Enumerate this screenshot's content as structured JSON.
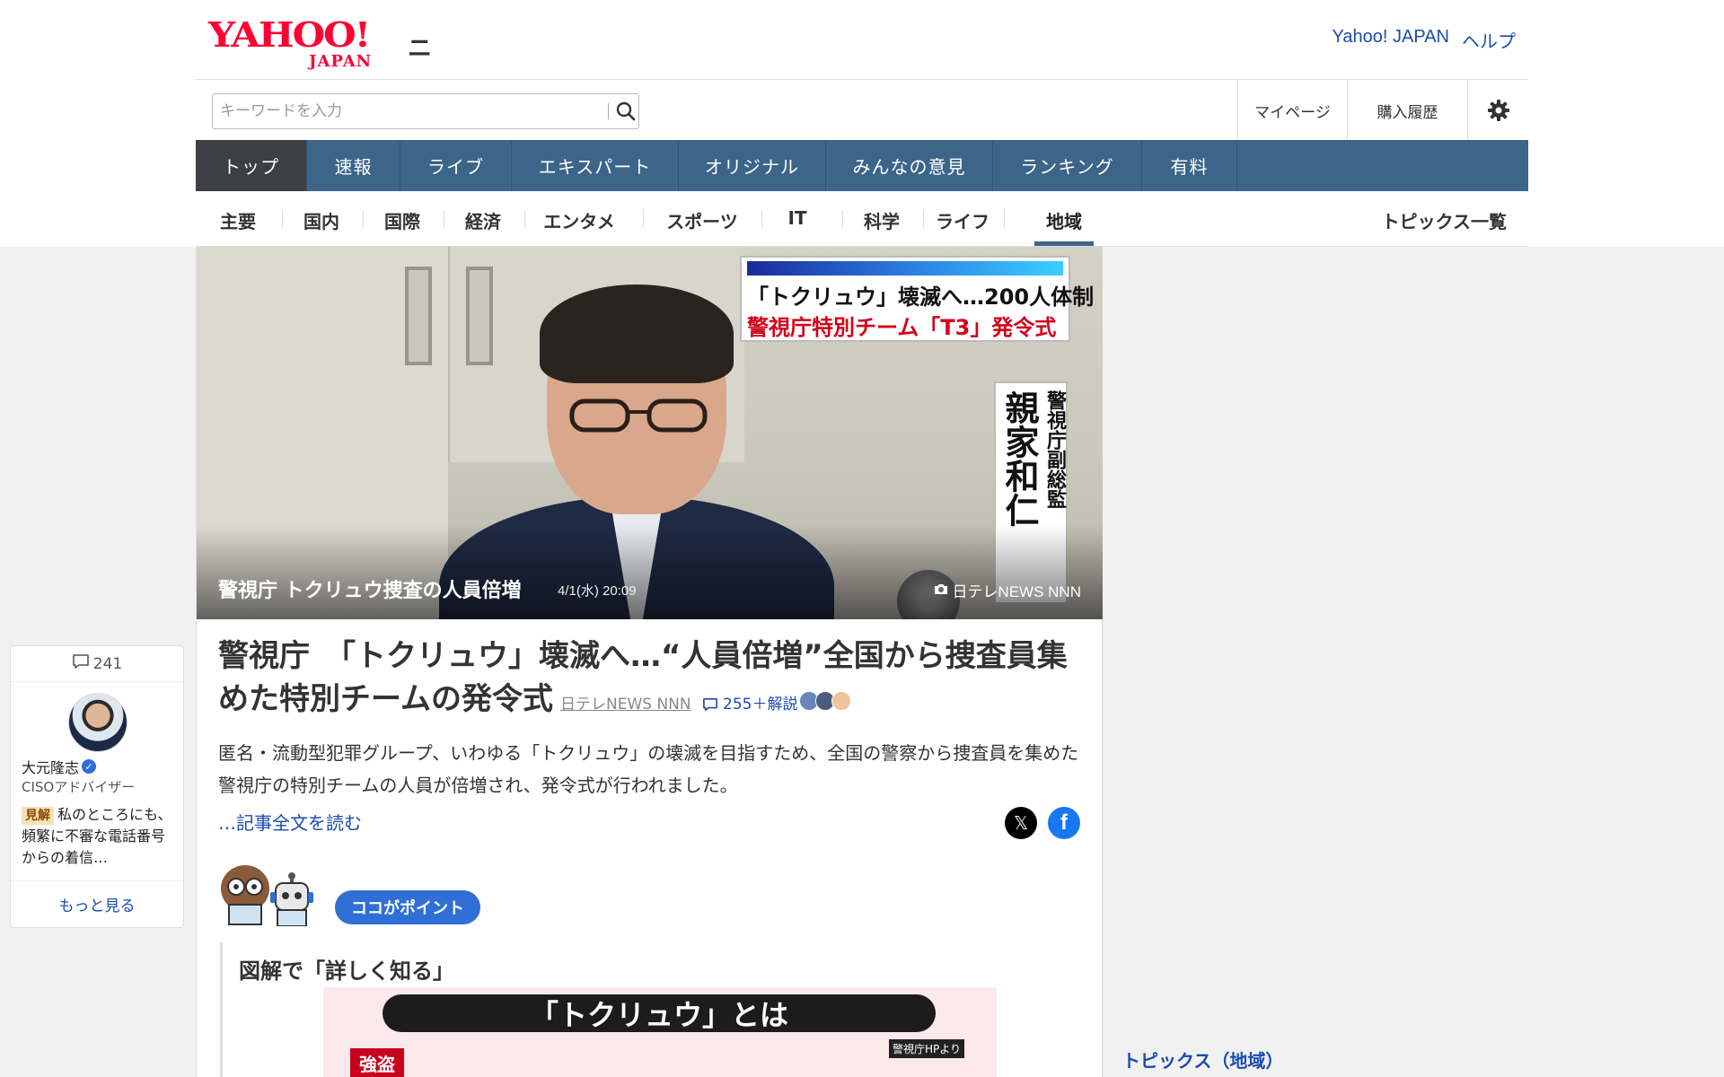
{
  "header": {
    "logo_yahoo": "YAHOO!",
    "logo_japan": "JAPAN",
    "logo_news": "ニュース",
    "link_yahoo_japan": "Yahoo! JAPAN",
    "link_help": "ヘルプ"
  },
  "search": {
    "placeholder": "キーワードを入力",
    "mypage": "マイページ",
    "history": "購入履歴"
  },
  "main_nav": [
    {
      "label": "トップ",
      "active": true
    },
    {
      "label": "速報"
    },
    {
      "label": "ライブ"
    },
    {
      "label": "エキスパート"
    },
    {
      "label": "オリジナル"
    },
    {
      "label": "みんなの意見"
    },
    {
      "label": "ランキング"
    },
    {
      "label": "有料"
    }
  ],
  "sub_nav": [
    {
      "label": "主要"
    },
    {
      "label": "国内"
    },
    {
      "label": "国際"
    },
    {
      "label": "経済"
    },
    {
      "label": "エンタメ"
    },
    {
      "label": "スポーツ"
    },
    {
      "label": "IT"
    },
    {
      "label": "科学"
    },
    {
      "label": "ライフ"
    },
    {
      "label": "地域",
      "active": true
    }
  ],
  "topics_list": "トピックス一覧",
  "comment_widget": {
    "count": "241",
    "name": "大元隆志",
    "title": "CISOアドバイザー",
    "badge": "見解",
    "text": "私のところにも、頻繁に不審な電話番号からの着信…",
    "more": "もっと見る"
  },
  "hero": {
    "caption_line1": "「トクリュウ」壊滅へ…200人体制",
    "caption_line2": "警視庁特別チーム「T3」発令式",
    "name_big": "親家和仁",
    "name_small": "警視庁副総監",
    "title": "警視庁 トクリュウ捜査の人員倍増",
    "date": "4/1(水) 20:09",
    "source": "日テレNEWS NNN"
  },
  "article": {
    "headline": "警視庁　「トクリュウ」壊滅へ…“人員倍増”全国から捜査員集めた特別チームの発令式",
    "source": "日テレNEWS NNN",
    "comments": "255＋解説",
    "summary": "匿名・流動型犯罪グループ、いわゆる「トクリュウ」の壊滅を目指すため、全国の警察から捜査員を集めた警視庁の特別チームの人員が倍増され、発令式が行われました。",
    "read_more": "…記事全文を読む",
    "point_badge": "ココがポイント",
    "diagram_heading": "図解で「詳しく知る」",
    "diagram_title": "「トクリュウ」とは",
    "diagram_source": "警視庁HPより",
    "diagram_label": "強盗"
  },
  "right": {
    "topics_region": "トピックス（地域）"
  },
  "colors": {
    "nav_bg": "#3c6589",
    "nav_active": "#3d3f44",
    "link": "#1a4bb0",
    "logo_red": "#ff0033",
    "point_blue": "#2f6fd6"
  }
}
